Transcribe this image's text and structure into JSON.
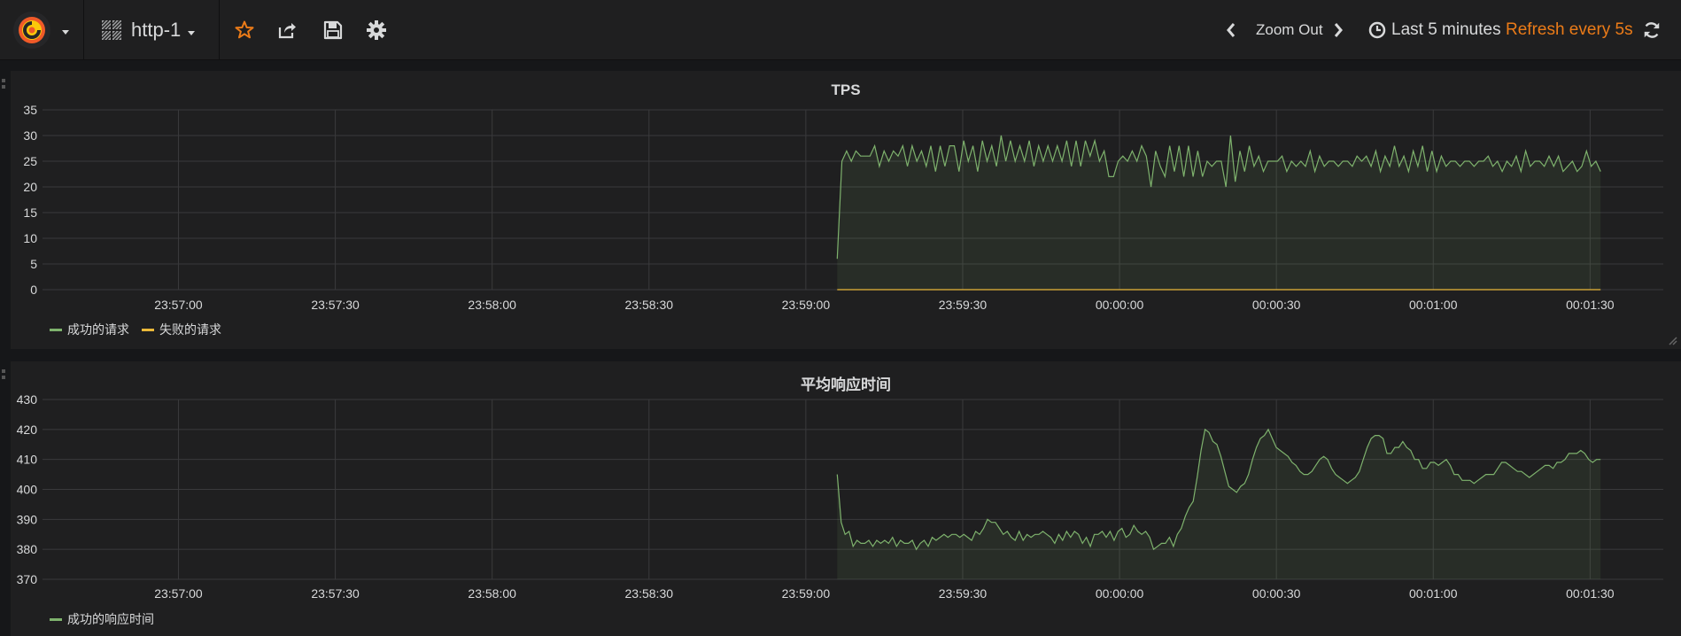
{
  "navbar": {
    "dashboard_title": "http-1",
    "zoom_out_label": "Zoom Out",
    "time_range_label": "Last 5 minutes",
    "refresh_label": "Refresh every 5s",
    "icons": [
      "grafana-logo-icon",
      "dashboard-grid-icon",
      "star-icon",
      "share-icon",
      "save-icon",
      "settings-gear-icon",
      "chevron-left-icon",
      "chevron-right-icon",
      "clock-icon",
      "refresh-icon"
    ]
  },
  "colors": {
    "success": "#7eb26d",
    "failure": "#eab839",
    "refresh_accent": "#eb7b18"
  },
  "panels": [
    {
      "title": "TPS",
      "legend": [
        {
          "label": "成功的请求",
          "color": "#7eb26d"
        },
        {
          "label": "失败的请求",
          "color": "#eab839"
        }
      ]
    },
    {
      "title": "平均响应时间",
      "legend": [
        {
          "label": "成功的响应时间",
          "color": "#7eb26d"
        }
      ]
    }
  ],
  "chart_data": [
    {
      "type": "line",
      "title": "TPS",
      "x_tick_labels": [
        "23:57:00",
        "23:57:30",
        "23:58:00",
        "23:58:30",
        "23:59:00",
        "23:59:30",
        "00:00:00",
        "00:00:30",
        "00:01:00",
        "00:01:30"
      ],
      "y_ticks": [
        0,
        5,
        10,
        15,
        20,
        25,
        30,
        35
      ],
      "ylim": [
        0,
        35
      ],
      "xlim_seconds": [
        -206,
        104
      ],
      "grid": true,
      "legend_position": "bottom-left",
      "series": [
        {
          "name": "成功的请求",
          "color": "#7eb26d",
          "fill": true,
          "x_start_seconds": -54,
          "x_end_seconds": 92,
          "values": [
            6,
            25,
            27,
            25,
            27,
            26,
            26,
            26,
            28,
            24,
            27,
            25,
            27,
            26,
            28,
            24,
            28,
            25,
            27,
            24,
            28,
            23,
            28,
            24,
            28,
            28,
            23,
            29,
            25,
            28,
            23,
            29,
            25,
            28,
            24,
            30,
            25,
            29,
            25,
            28,
            25,
            29,
            24,
            28,
            25,
            28,
            25,
            28,
            25,
            29,
            24,
            29,
            24,
            29,
            26,
            29,
            25,
            27,
            22,
            22,
            25,
            26,
            25,
            27,
            25,
            28,
            26,
            20,
            27,
            24,
            22,
            28,
            23,
            28,
            22,
            28,
            22,
            27,
            22,
            25,
            24,
            25,
            25,
            20,
            30,
            21,
            27,
            23,
            28,
            24,
            26,
            23,
            25,
            25,
            25,
            26,
            23,
            25,
            24,
            25,
            24,
            27,
            23,
            26,
            24,
            25,
            25,
            24,
            25,
            25,
            24,
            26,
            25,
            26,
            24,
            27,
            23,
            26,
            24,
            28,
            24,
            26,
            23,
            27,
            24,
            28,
            23,
            27,
            23,
            26,
            24,
            25,
            25,
            24,
            25,
            25,
            24,
            25,
            25,
            26,
            24,
            25,
            23,
            25,
            24,
            26,
            23,
            27,
            24,
            25,
            25,
            24,
            26,
            24,
            26,
            23,
            24,
            25,
            23,
            24,
            27,
            24,
            25,
            23
          ]
        },
        {
          "name": "失败的请求",
          "color": "#eab839",
          "fill": false,
          "x_start_seconds": -54,
          "x_end_seconds": 92,
          "values": [
            0,
            0
          ]
        }
      ]
    },
    {
      "type": "line",
      "title": "平均响应时间",
      "x_tick_labels": [
        "23:57:00",
        "23:57:30",
        "23:58:00",
        "23:58:30",
        "23:59:00",
        "23:59:30",
        "00:00:00",
        "00:00:30",
        "00:01:00",
        "00:01:30"
      ],
      "y_ticks": [
        370,
        380,
        390,
        400,
        410,
        420,
        430
      ],
      "ylim": [
        370,
        430
      ],
      "xlim_seconds": [
        -206,
        104
      ],
      "grid": true,
      "legend_position": "bottom-left",
      "series": [
        {
          "name": "成功的响应时间",
          "color": "#7eb26d",
          "fill": true,
          "x_start_seconds": -54,
          "x_end_seconds": 92,
          "values": [
            405,
            389,
            385,
            386,
            381,
            383,
            382,
            382,
            383,
            381,
            383,
            382,
            383,
            382,
            384,
            381,
            383,
            382,
            382,
            383,
            380,
            382,
            383,
            381,
            384,
            383,
            384,
            385,
            384,
            385,
            385,
            384,
            385,
            384,
            383,
            386,
            385,
            387,
            390,
            389,
            389,
            387,
            385,
            386,
            384,
            383,
            386,
            383,
            385,
            384,
            385,
            385,
            386,
            385,
            384,
            382,
            385,
            383,
            386,
            384,
            386,
            385,
            382,
            384,
            381,
            385,
            385,
            386,
            384,
            386,
            383,
            386,
            387,
            384,
            385,
            388,
            386,
            385,
            386,
            384,
            380,
            381,
            382,
            382,
            384,
            381,
            385,
            387,
            391,
            394,
            396,
            404,
            413,
            420,
            419,
            416,
            415,
            411,
            406,
            401,
            400,
            399,
            401,
            402,
            405,
            410,
            414,
            417,
            418,
            420,
            417,
            414,
            413,
            412,
            411,
            409,
            408,
            406,
            405,
            405,
            406,
            408,
            410,
            411,
            410,
            407,
            405,
            404,
            403,
            402,
            403,
            404,
            406,
            410,
            414,
            417,
            418,
            418,
            417,
            412,
            412,
            414,
            414,
            416,
            414,
            413,
            410,
            410,
            407,
            407,
            409,
            409,
            408,
            409,
            410,
            408,
            405,
            405,
            403,
            403,
            403,
            402,
            403,
            404,
            405,
            405,
            405,
            407,
            409,
            409,
            408,
            407,
            406,
            406,
            405,
            404,
            405,
            406,
            407,
            408,
            408,
            407,
            409,
            409,
            410,
            412,
            412,
            412,
            413,
            412,
            410,
            409,
            410,
            410
          ]
        }
      ]
    }
  ]
}
